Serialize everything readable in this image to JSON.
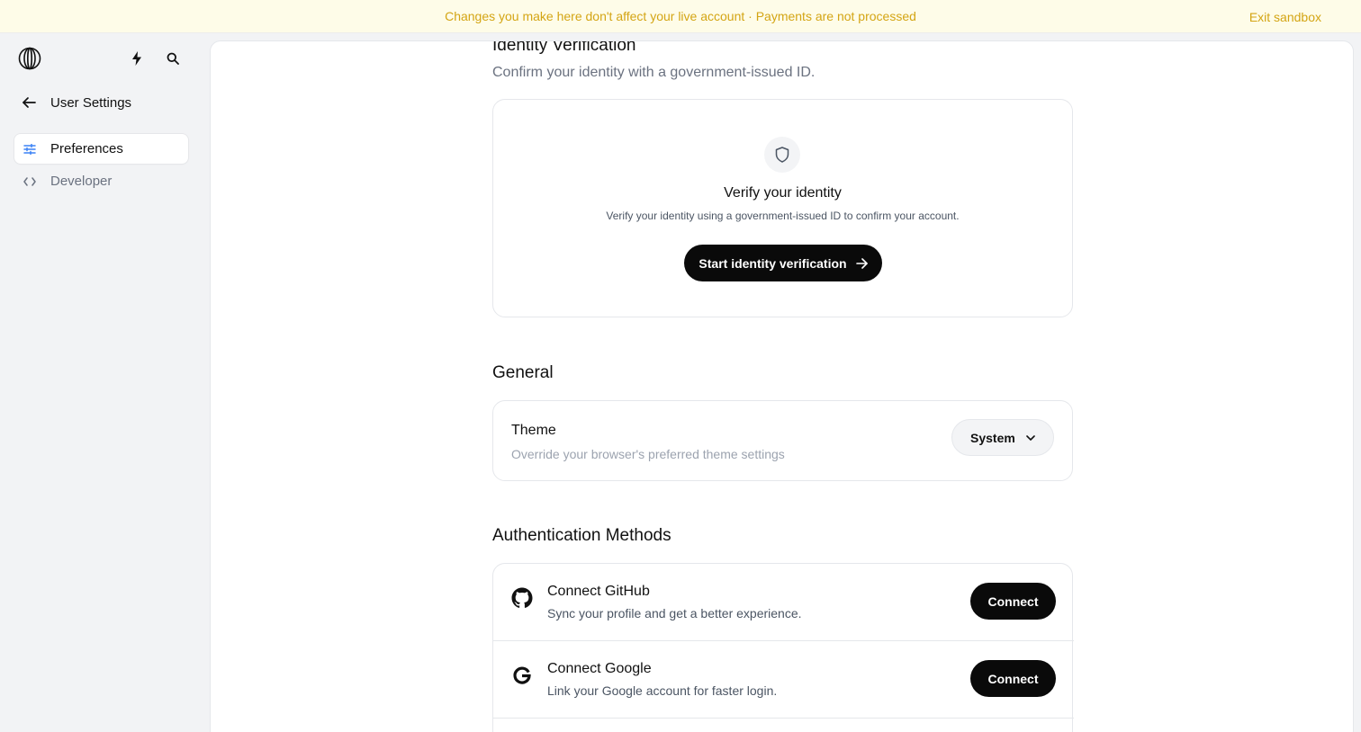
{
  "banner": {
    "message": "Changes you make here don't affect your live account · Payments are not processed",
    "exit_label": "Exit sandbox"
  },
  "sidebar": {
    "back_label": "User Settings",
    "items": [
      {
        "label": "Preferences",
        "icon": "sliders-icon",
        "active": true
      },
      {
        "label": "Developer",
        "icon": "code-icon",
        "active": false
      }
    ]
  },
  "identity": {
    "heading": "Identity Verification",
    "subheading": "Confirm your identity with a government-issued ID.",
    "card_title": "Verify your identity",
    "card_desc": "Verify your identity using a government-issued ID to confirm your account.",
    "button_label": "Start identity verification"
  },
  "general": {
    "heading": "General",
    "theme_title": "Theme",
    "theme_desc": "Override your browser's preferred theme settings",
    "theme_value": "System"
  },
  "auth": {
    "heading": "Authentication Methods",
    "methods": [
      {
        "title": "Connect GitHub",
        "desc": "Sync your profile and get a better experience.",
        "button": "Connect",
        "icon": "github-icon"
      },
      {
        "title": "Connect Google",
        "desc": "Link your Google account for faster login.",
        "button": "Connect",
        "icon": "google-icon"
      }
    ]
  },
  "colors": {
    "banner_bg": "#fefce8",
    "banner_text": "#d4a514",
    "accent_blue": "#3b82f6",
    "button_dark": "#0a0a0a"
  }
}
